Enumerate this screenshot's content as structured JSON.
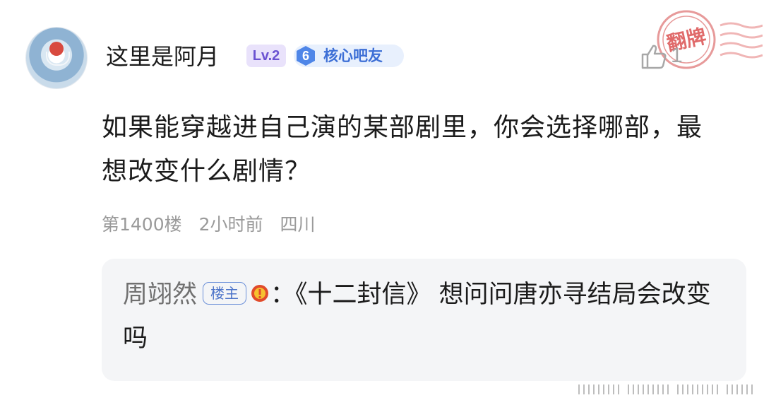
{
  "post": {
    "username": "这里是阿月",
    "level_badge": "Lv.2",
    "fan_level": "6",
    "fan_label": "核心吧友",
    "like_count": "1",
    "stamp_text": "翻牌",
    "question": "如果能穿越进自己演的某部剧里，你会选择哪部，最想改变什么剧情？",
    "meta": {
      "floor": "第1400楼",
      "time": "2小时前",
      "location": "四川"
    }
  },
  "reply": {
    "username": "周翊然",
    "owner_tag": "楼主",
    "colon": "：",
    "text": "《十二封信》 想问问唐亦寻结局会改变吗"
  },
  "colors": {
    "accent_purple": "#6b52d1",
    "accent_blue": "#3d6fd6",
    "stamp_red": "#e06a6a",
    "reply_bg": "#f4f5f7"
  },
  "icons": {
    "like": "thumbs-up-icon",
    "warning": "warning-icon",
    "stamp": "stamp-icon"
  }
}
